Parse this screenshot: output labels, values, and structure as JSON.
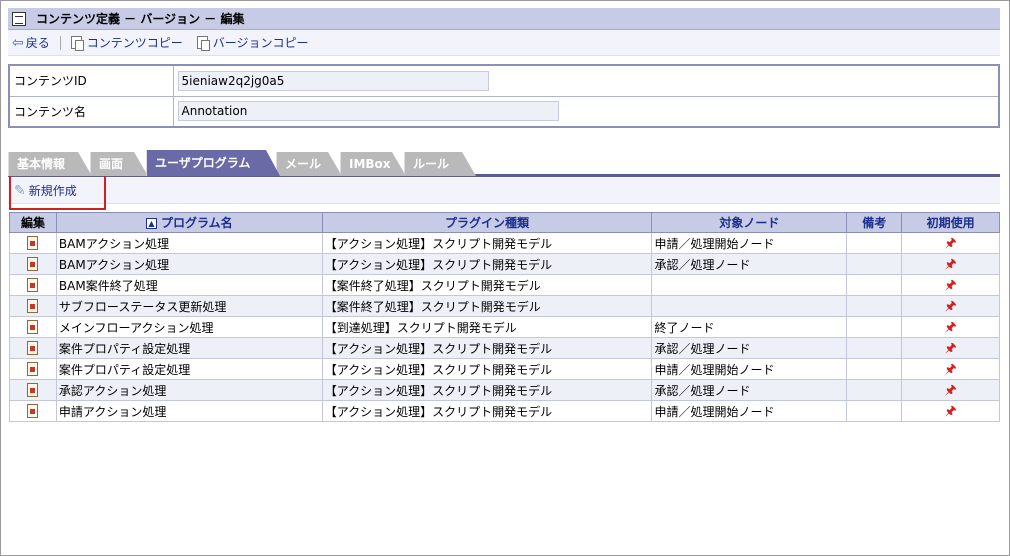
{
  "window": {
    "title": "コンテンツ定義 － バージョン － 編集"
  },
  "toolbar": {
    "back_label": "戻る",
    "content_copy_label": "コンテンツコピー",
    "version_copy_label": "バージョンコピー"
  },
  "info": {
    "content_id_label": "コンテンツID",
    "content_id_value": "5ieniaw2q2jg0a5",
    "content_name_label": "コンテンツ名",
    "content_name_value": "Annotation"
  },
  "tabs": [
    {
      "label": "基本情報",
      "active": false
    },
    {
      "label": "画面",
      "active": false
    },
    {
      "label": "ユーザプログラム",
      "active": true
    },
    {
      "label": "メール",
      "active": false
    },
    {
      "label": "IMBox",
      "active": false
    },
    {
      "label": "ルール",
      "active": false
    }
  ],
  "new_button": {
    "label": "新規作成"
  },
  "table": {
    "headers": {
      "edit": "編集",
      "program_name": "プログラム名",
      "plugin_type": "プラグイン種類",
      "target_node": "対象ノード",
      "remarks": "備考",
      "initial_use": "初期使用"
    },
    "rows": [
      {
        "program_name": "BAMアクション処理",
        "plugin_type": "【アクション処理】スクリプト開発モデル",
        "target_node": "申請／処理開始ノード",
        "remarks": ""
      },
      {
        "program_name": "BAMアクション処理",
        "plugin_type": "【アクション処理】スクリプト開発モデル",
        "target_node": "承認／処理ノード",
        "remarks": ""
      },
      {
        "program_name": "BAM案件終了処理",
        "plugin_type": "【案件終了処理】スクリプト開発モデル",
        "target_node": "",
        "remarks": ""
      },
      {
        "program_name": "サブフローステータス更新処理",
        "plugin_type": "【案件終了処理】スクリプト開発モデル",
        "target_node": "",
        "remarks": ""
      },
      {
        "program_name": "メインフローアクション処理",
        "plugin_type": "【到達処理】スクリプト開発モデル",
        "target_node": "終了ノード",
        "remarks": ""
      },
      {
        "program_name": "案件プロパティ設定処理",
        "plugin_type": "【アクション処理】スクリプト開発モデル",
        "target_node": "承認／処理ノード",
        "remarks": ""
      },
      {
        "program_name": "案件プロパティ設定処理",
        "plugin_type": "【アクション処理】スクリプト開発モデル",
        "target_node": "申請／処理開始ノード",
        "remarks": ""
      },
      {
        "program_name": "承認アクション処理",
        "plugin_type": "【アクション処理】スクリプト開発モデル",
        "target_node": "承認／処理ノード",
        "remarks": ""
      },
      {
        "program_name": "申請アクション処理",
        "plugin_type": "【アクション処理】スクリプト開発モデル",
        "target_node": "申請／処理開始ノード",
        "remarks": ""
      }
    ]
  },
  "icons": {
    "edit": "edit-icon",
    "initial_use": "flag-icon",
    "sort": "sort-ascending-icon"
  },
  "colors": {
    "header_bg": "#c7cbe6",
    "active_tab": "#6a6aa6",
    "highlight_box": "#d02020",
    "link": "#1b2f8f"
  }
}
